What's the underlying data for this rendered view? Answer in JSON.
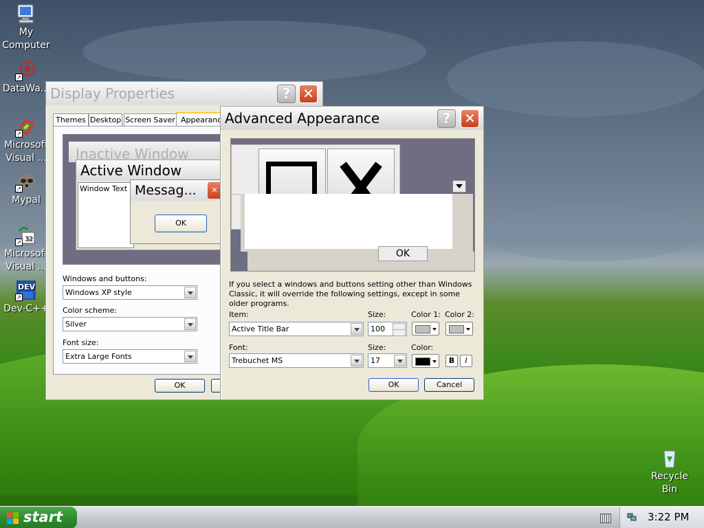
{
  "desktop": {
    "icons": [
      {
        "label": "My Computer",
        "icon": "my-computer-icon"
      },
      {
        "label": "DataWa...",
        "icon": "datawarehouse-icon"
      },
      {
        "label": "Microsoft Visual ...",
        "icon": "visual-studio-icon"
      },
      {
        "label": "Mypal",
        "icon": "mypal-icon"
      },
      {
        "label": "Microsoft Visual ...",
        "icon": "visual-foxpro-icon"
      },
      {
        "label": "Dev-C++",
        "icon": "dev-cpp-icon"
      },
      {
        "label": "Recycle Bin",
        "icon": "recycle-bin-icon"
      }
    ]
  },
  "display_props": {
    "title": "Display Properties",
    "tabs": [
      "Themes",
      "Desktop",
      "Screen Saver",
      "Appearance"
    ],
    "preview": {
      "inactive": "Inactive Window",
      "active": "Active Window",
      "window_text": "Window Text",
      "message": "Messag...",
      "ok": "OK"
    },
    "windows_buttons_label": "Windows and buttons:",
    "windows_buttons_value": "Windows XP style",
    "color_scheme_label": "Color scheme:",
    "color_scheme_value": "Silver",
    "font_size_label": "Font size:",
    "font_size_value": "Extra Large Fonts",
    "ok": "OK"
  },
  "advanced": {
    "title": "Advanced Appearance",
    "preview_ok": "OK",
    "info": "If you select a windows and buttons setting other than Windows Classic, it will override the following settings, except in some older programs.",
    "item_label": "Item:",
    "item_value": "Active Title Bar",
    "size_label": "Size:",
    "size_value": "100",
    "color1_label": "Color 1:",
    "color2_label": "Color 2:",
    "font_label": "Font:",
    "font_value": "Trebuchet MS",
    "font_size_label": "Size:",
    "font_size_value": "17",
    "color_label": "Color:",
    "bold": "B",
    "italic": "I",
    "ok": "OK",
    "cancel": "Cancel",
    "colors": {
      "color1": "#c0c0c0",
      "color2": "#c0c0c0",
      "font_color": "#000000"
    }
  },
  "taskbar": {
    "start": "start",
    "clock": "3:22 PM"
  }
}
